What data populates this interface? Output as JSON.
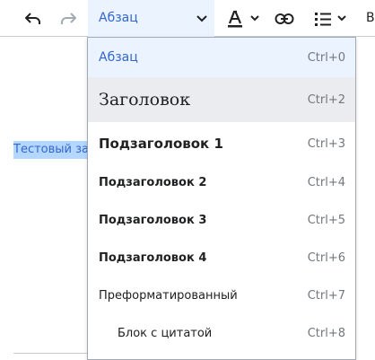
{
  "toolbar": {
    "undo_icon": "undo-icon",
    "redo_icon": "redo-icon",
    "format_select": {
      "value": "Абзац"
    },
    "text_style_icon": "text-style-icon",
    "link_icon": "link-icon",
    "list_icon": "bullet-list-icon",
    "more_label": "В"
  },
  "editor": {
    "selected_text": "Тестовый за"
  },
  "dropdown": {
    "items": [
      {
        "label": "Абзац",
        "shortcut": "Ctrl+0"
      },
      {
        "label": "Заголовок",
        "shortcut": "Ctrl+2"
      },
      {
        "label": "Подзаголовок 1",
        "shortcut": "Ctrl+3"
      },
      {
        "label": "Подзаголовок 2",
        "shortcut": "Ctrl+4"
      },
      {
        "label": "Подзаголовок 3",
        "shortcut": "Ctrl+5"
      },
      {
        "label": "Подзаголовок 4",
        "shortcut": "Ctrl+6"
      },
      {
        "label": "Преформатированный",
        "shortcut": "Ctrl+7"
      },
      {
        "label": "Блок с цитатой",
        "shortcut": "Ctrl+8"
      }
    ]
  },
  "colors": {
    "accent": "#3366cc",
    "selected_bg": "#eaf3ff",
    "hover_bg": "#eaecf0",
    "selection_highlight": "#b4d7ff"
  }
}
